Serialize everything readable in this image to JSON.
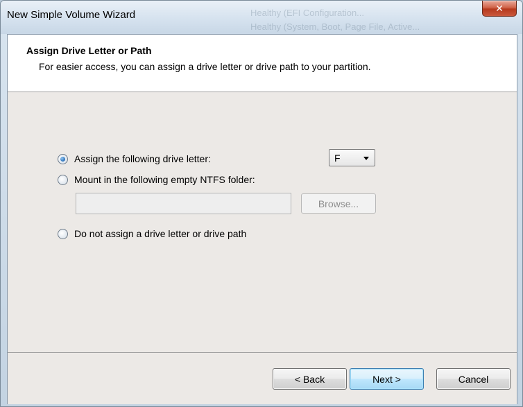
{
  "window": {
    "title": "New Simple Volume Wizard",
    "close_glyph": "✕"
  },
  "background_text": {
    "line1": "Healthy (EFI Configuration...",
    "line2": "Healthy (System, Boot, Page File, Active..."
  },
  "header": {
    "title": "Assign Drive Letter or Path",
    "subtitle": "For easier access, you can assign a drive letter or drive path to your partition."
  },
  "options": {
    "assign_letter": {
      "label": "Assign the following drive letter:",
      "selected": true
    },
    "mount_folder": {
      "label": "Mount in the following empty NTFS folder:",
      "selected": false
    },
    "no_assign": {
      "label": "Do not assign a drive letter or drive path",
      "selected": false
    }
  },
  "drive_letter": {
    "value": "F"
  },
  "folder_path": {
    "value": "",
    "enabled": false
  },
  "browse": {
    "label": "Browse...",
    "enabled": false
  },
  "buttons": {
    "back": "< Back",
    "next": "Next >",
    "cancel": "Cancel"
  },
  "colors": {
    "accent": "#3c7fb1",
    "radio_fill": "#2a6fb6",
    "close": "#c9573b"
  }
}
